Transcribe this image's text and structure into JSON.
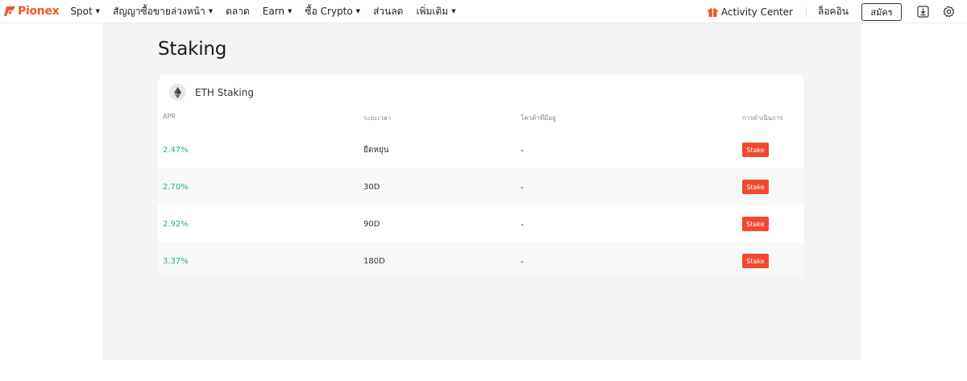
{
  "brand": {
    "name": "Pionex",
    "color": "#f0582a"
  },
  "nav": {
    "items": [
      {
        "label": "Spot",
        "dropdown": true
      },
      {
        "label": "สัญญาซื้อขายล่วงหน้า",
        "dropdown": true
      },
      {
        "label": "ตลาด",
        "dropdown": false
      },
      {
        "label": "Earn",
        "dropdown": true
      },
      {
        "label": "ซื้อ Crypto",
        "dropdown": true
      },
      {
        "label": "ส่วนลด",
        "dropdown": false
      },
      {
        "label": "เพิ่มเติม",
        "dropdown": true
      }
    ],
    "activity_label": "Activity Center",
    "login_label": "ล็อคอิน",
    "signup_label": "สมัคร",
    "download_icon": "download-icon",
    "settings_icon": "gear-icon"
  },
  "page": {
    "title": "Staking"
  },
  "staking": {
    "coin": {
      "name": "ETH Staking",
      "icon": "ethereum-icon"
    },
    "columns": [
      "APR",
      "ระยะเวลา",
      "โควต้าที่มีอยู่",
      "การดำเนินการ"
    ],
    "rows": [
      {
        "apr": "2.47%",
        "period": "ยืดหยุ่น",
        "quota": "-",
        "action": "Stake"
      },
      {
        "apr": "2.70%",
        "period": "30D",
        "quota": "-",
        "action": "Stake"
      },
      {
        "apr": "2.92%",
        "period": "90D",
        "quota": "-",
        "action": "Stake"
      },
      {
        "apr": "3.37%",
        "period": "180D",
        "quota": "-",
        "action": "Stake"
      }
    ]
  },
  "colors": {
    "apr_green": "#2eb07a",
    "stake_button": "#f3492f",
    "page_bg": "#f4f4f6"
  }
}
